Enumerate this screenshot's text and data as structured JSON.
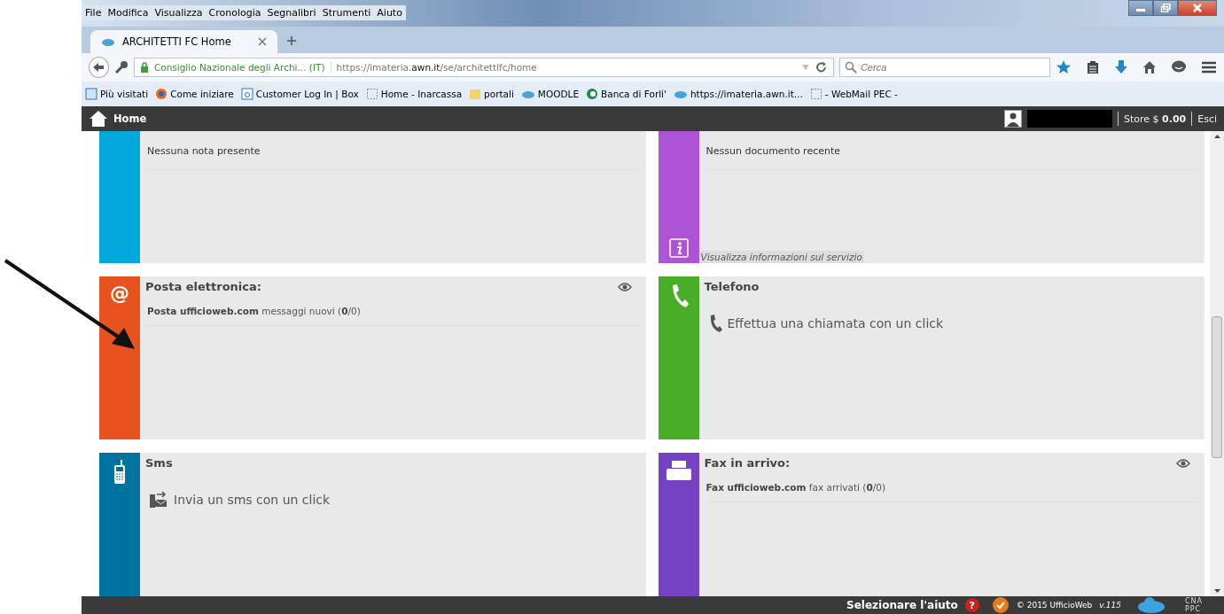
{
  "menu": [
    "File",
    "Modifica",
    "Visualizza",
    "Cronologia",
    "Segnalibri",
    "Strumenti",
    "Aiuto"
  ],
  "tabs": [
    {
      "label": "ARCHITETTI FC Home",
      "selected": true
    }
  ],
  "address": {
    "identity": "Consiglio Nazionale degli Archi... (IT)",
    "url": "https://imateria.**awn.it**/se/architettifc/home"
  },
  "search": {
    "placeholder": "Cerca"
  },
  "bookmarks": [
    {
      "label": "Più visitati",
      "kind": "pages"
    },
    {
      "label": "Come iniziare",
      "kind": "firefox"
    },
    {
      "label": "Customer Log In | Box",
      "kind": "box"
    },
    {
      "label": "Home - Inarcassa",
      "kind": "blank"
    },
    {
      "label": "portali",
      "kind": "folder"
    },
    {
      "label": "MOODLE",
      "kind": "cloud"
    },
    {
      "label": "Banca di Forli'",
      "kind": "bank"
    },
    {
      "label": "https://imateria.awn.it...",
      "kind": "cloud"
    },
    {
      "label": "- WebMail PEC -",
      "kind": "blank"
    }
  ],
  "app_header": {
    "title": "Home",
    "store": "Store $ **0.00**",
    "logout": "Esci"
  },
  "cards": [
    {
      "kind": "notes",
      "color": "#00a8db",
      "message": "Nessuna nota presente"
    },
    {
      "kind": "documents",
      "color": "#ad53d8",
      "message": "Nessun documento recente",
      "link": "Visualizza informazioni sul servizio"
    },
    {
      "kind": "mail",
      "color": "#e8521e",
      "icon_text": "@",
      "title": "Posta elettronica:",
      "line": "**Posta ufficioweb.com** messaggi nuovi (**0**/0)"
    },
    {
      "kind": "phone",
      "color": "#4aad27",
      "title": "Telefono",
      "action": "Effettua una chiamata con un click"
    },
    {
      "kind": "sms",
      "color": "#0072a0",
      "title": "Sms",
      "action": "Invia un sms con un click"
    },
    {
      "kind": "fax",
      "color": "#7442c2",
      "title": "Fax in arrivo:",
      "line": "**Fax ufficioweb.com** fax arrivati (**0**/0)"
    }
  ],
  "footer": {
    "help": "Selezionare l'aiuto",
    "help_icon": "?",
    "copyright": "© 2015 UfficioWeb",
    "version": "v.115",
    "logo_top": "CNA",
    "logo_bottom": "PPC"
  }
}
